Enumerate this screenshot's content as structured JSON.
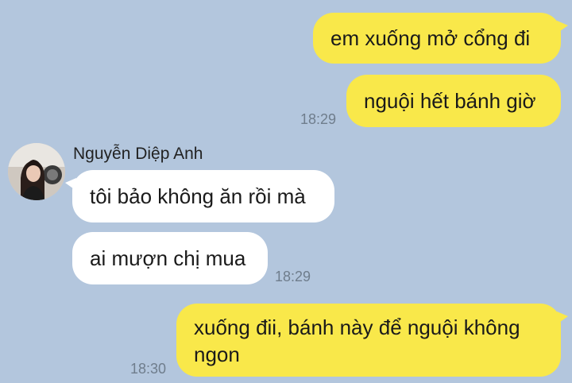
{
  "conversation": {
    "messages": [
      {
        "direction": "out",
        "text": "em xuống mở cổng đi"
      },
      {
        "direction": "out",
        "text": "nguội hết bánh giờ",
        "time": "18:29"
      },
      {
        "direction": "in",
        "sender": "Nguyễn Diệp Anh",
        "text": "tôi bảo không ăn rồi mà"
      },
      {
        "direction": "in",
        "text": "ai mượn chị mua",
        "time": "18:29"
      },
      {
        "direction": "out",
        "text_line1": "xuống đii, bánh này để nguội không",
        "text_line2": "ngon",
        "time": "18:30"
      }
    ]
  },
  "avatar_icon": "contact-photo",
  "colors": {
    "background": "#b3c6dd",
    "outgoing_bubble": "#f9e84a",
    "incoming_bubble": "#ffffff",
    "timestamp": "#6f7d8c"
  }
}
